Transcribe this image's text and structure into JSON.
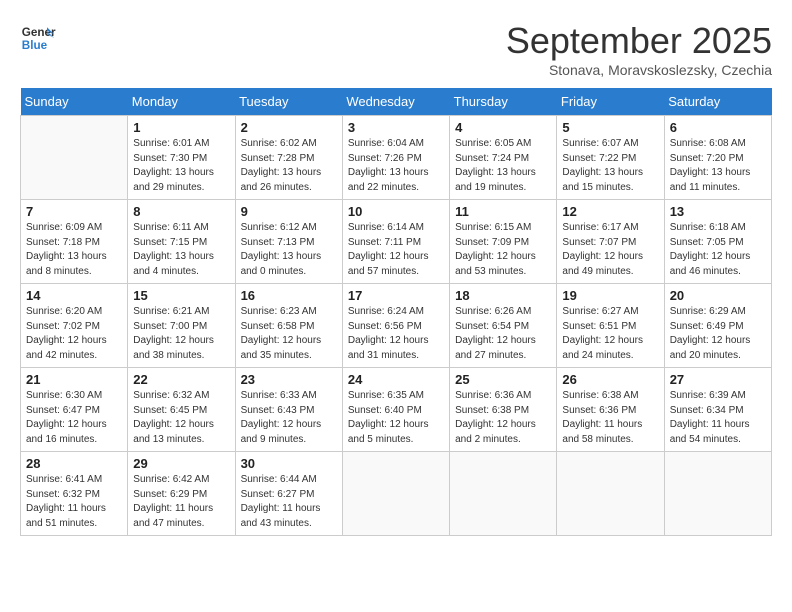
{
  "header": {
    "logo_line1": "General",
    "logo_line2": "Blue",
    "month_title": "September 2025",
    "location": "Stonava, Moravskoslezsky, Czechia"
  },
  "days_of_week": [
    "Sunday",
    "Monday",
    "Tuesday",
    "Wednesday",
    "Thursday",
    "Friday",
    "Saturday"
  ],
  "weeks": [
    [
      {
        "day": "",
        "info": ""
      },
      {
        "day": "1",
        "info": "Sunrise: 6:01 AM\nSunset: 7:30 PM\nDaylight: 13 hours\nand 29 minutes."
      },
      {
        "day": "2",
        "info": "Sunrise: 6:02 AM\nSunset: 7:28 PM\nDaylight: 13 hours\nand 26 minutes."
      },
      {
        "day": "3",
        "info": "Sunrise: 6:04 AM\nSunset: 7:26 PM\nDaylight: 13 hours\nand 22 minutes."
      },
      {
        "day": "4",
        "info": "Sunrise: 6:05 AM\nSunset: 7:24 PM\nDaylight: 13 hours\nand 19 minutes."
      },
      {
        "day": "5",
        "info": "Sunrise: 6:07 AM\nSunset: 7:22 PM\nDaylight: 13 hours\nand 15 minutes."
      },
      {
        "day": "6",
        "info": "Sunrise: 6:08 AM\nSunset: 7:20 PM\nDaylight: 13 hours\nand 11 minutes."
      }
    ],
    [
      {
        "day": "7",
        "info": "Sunrise: 6:09 AM\nSunset: 7:18 PM\nDaylight: 13 hours\nand 8 minutes."
      },
      {
        "day": "8",
        "info": "Sunrise: 6:11 AM\nSunset: 7:15 PM\nDaylight: 13 hours\nand 4 minutes."
      },
      {
        "day": "9",
        "info": "Sunrise: 6:12 AM\nSunset: 7:13 PM\nDaylight: 13 hours\nand 0 minutes."
      },
      {
        "day": "10",
        "info": "Sunrise: 6:14 AM\nSunset: 7:11 PM\nDaylight: 12 hours\nand 57 minutes."
      },
      {
        "day": "11",
        "info": "Sunrise: 6:15 AM\nSunset: 7:09 PM\nDaylight: 12 hours\nand 53 minutes."
      },
      {
        "day": "12",
        "info": "Sunrise: 6:17 AM\nSunset: 7:07 PM\nDaylight: 12 hours\nand 49 minutes."
      },
      {
        "day": "13",
        "info": "Sunrise: 6:18 AM\nSunset: 7:05 PM\nDaylight: 12 hours\nand 46 minutes."
      }
    ],
    [
      {
        "day": "14",
        "info": "Sunrise: 6:20 AM\nSunset: 7:02 PM\nDaylight: 12 hours\nand 42 minutes."
      },
      {
        "day": "15",
        "info": "Sunrise: 6:21 AM\nSunset: 7:00 PM\nDaylight: 12 hours\nand 38 minutes."
      },
      {
        "day": "16",
        "info": "Sunrise: 6:23 AM\nSunset: 6:58 PM\nDaylight: 12 hours\nand 35 minutes."
      },
      {
        "day": "17",
        "info": "Sunrise: 6:24 AM\nSunset: 6:56 PM\nDaylight: 12 hours\nand 31 minutes."
      },
      {
        "day": "18",
        "info": "Sunrise: 6:26 AM\nSunset: 6:54 PM\nDaylight: 12 hours\nand 27 minutes."
      },
      {
        "day": "19",
        "info": "Sunrise: 6:27 AM\nSunset: 6:51 PM\nDaylight: 12 hours\nand 24 minutes."
      },
      {
        "day": "20",
        "info": "Sunrise: 6:29 AM\nSunset: 6:49 PM\nDaylight: 12 hours\nand 20 minutes."
      }
    ],
    [
      {
        "day": "21",
        "info": "Sunrise: 6:30 AM\nSunset: 6:47 PM\nDaylight: 12 hours\nand 16 minutes."
      },
      {
        "day": "22",
        "info": "Sunrise: 6:32 AM\nSunset: 6:45 PM\nDaylight: 12 hours\nand 13 minutes."
      },
      {
        "day": "23",
        "info": "Sunrise: 6:33 AM\nSunset: 6:43 PM\nDaylight: 12 hours\nand 9 minutes."
      },
      {
        "day": "24",
        "info": "Sunrise: 6:35 AM\nSunset: 6:40 PM\nDaylight: 12 hours\nand 5 minutes."
      },
      {
        "day": "25",
        "info": "Sunrise: 6:36 AM\nSunset: 6:38 PM\nDaylight: 12 hours\nand 2 minutes."
      },
      {
        "day": "26",
        "info": "Sunrise: 6:38 AM\nSunset: 6:36 PM\nDaylight: 11 hours\nand 58 minutes."
      },
      {
        "day": "27",
        "info": "Sunrise: 6:39 AM\nSunset: 6:34 PM\nDaylight: 11 hours\nand 54 minutes."
      }
    ],
    [
      {
        "day": "28",
        "info": "Sunrise: 6:41 AM\nSunset: 6:32 PM\nDaylight: 11 hours\nand 51 minutes."
      },
      {
        "day": "29",
        "info": "Sunrise: 6:42 AM\nSunset: 6:29 PM\nDaylight: 11 hours\nand 47 minutes."
      },
      {
        "day": "30",
        "info": "Sunrise: 6:44 AM\nSunset: 6:27 PM\nDaylight: 11 hours\nand 43 minutes."
      },
      {
        "day": "",
        "info": ""
      },
      {
        "day": "",
        "info": ""
      },
      {
        "day": "",
        "info": ""
      },
      {
        "day": "",
        "info": ""
      }
    ]
  ]
}
